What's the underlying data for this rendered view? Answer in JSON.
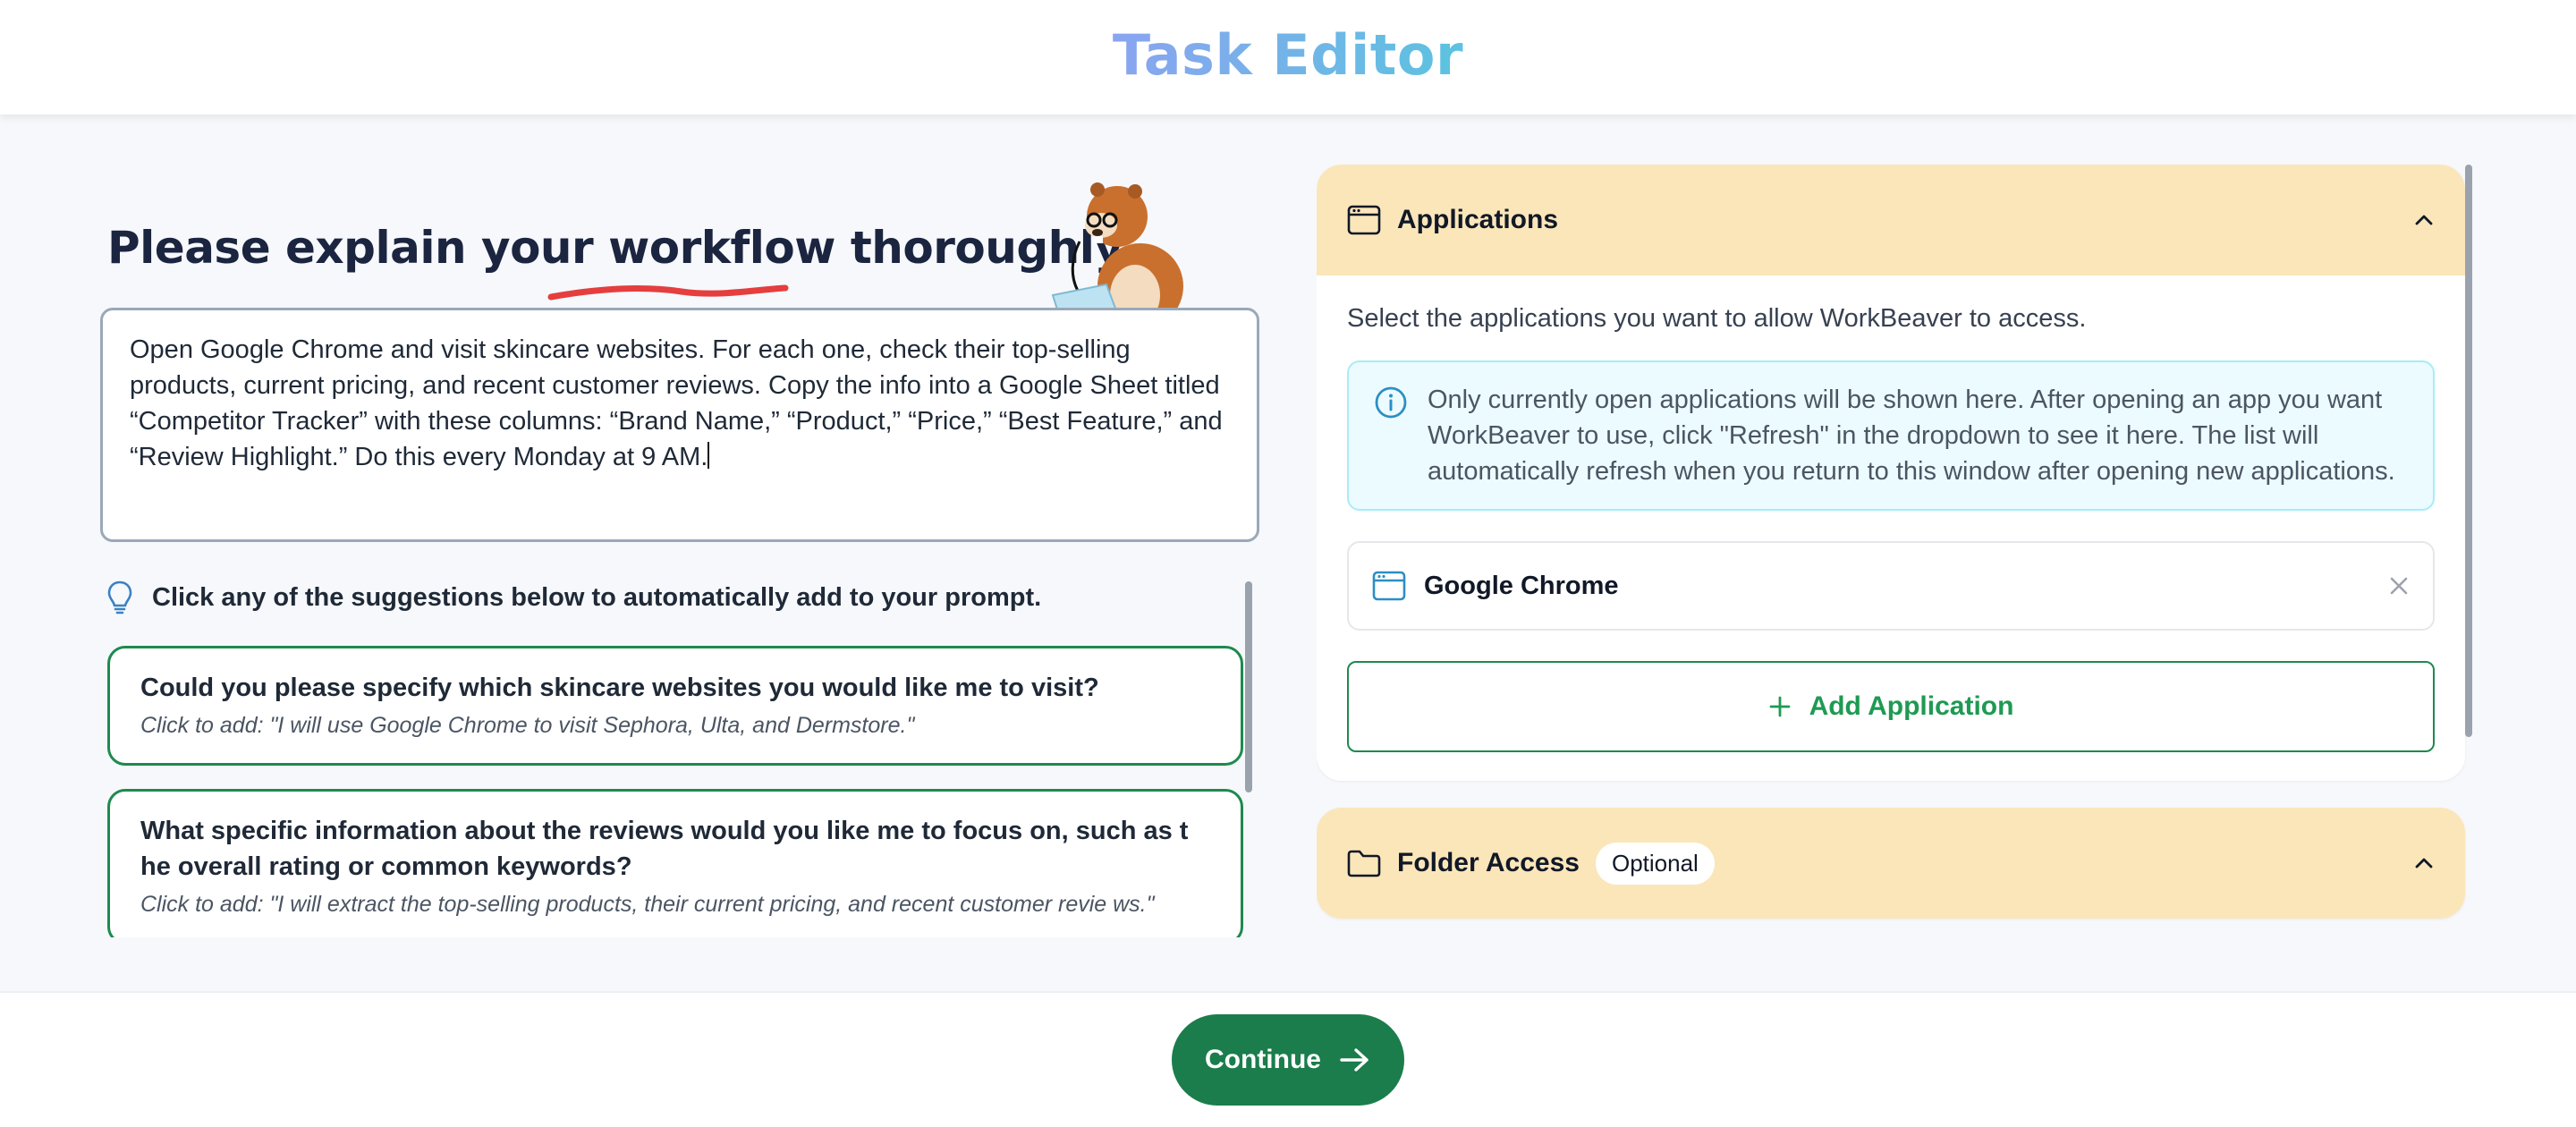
{
  "header": {
    "title": "Task Editor"
  },
  "left": {
    "headline": "Please explain your workflow thoroughly",
    "prompt_text": "Open Google Chrome and visit skincare websites. For each one, check their top-selling products, current pricing, and recent customer reviews. Copy the info into a Google Sheet titled “Competitor Tracker” with these columns: “Brand Name,” “Product,” “Price,” “Best Feature,” and “Review Highlight.” Do this every Monday at 9 AM.",
    "hint": "Click any of the suggestions below to automatically add to your prompt.",
    "suggestions": [
      {
        "question": "Could you please specify which skincare websites you would like me to visit?",
        "add": "Click to add: \"I will use Google Chrome to visit Sephora, Ulta, and Dermstore.\""
      },
      {
        "question": "What specific information about the reviews would you like me to focus on, such as t he overall rating or common keywords?",
        "add": "Click to add: \"I will extract the top-selling products, their current pricing, and recent customer revie ws.\""
      }
    ]
  },
  "applications": {
    "title": "Applications",
    "description": "Select the applications you want to allow WorkBeaver to access.",
    "info": "Only currently open applications will be shown here. After opening an app you want WorkBeaver to use, click \"Refresh\" in the dropdown to see it here. The list will automatically refresh when you return to this window after opening new applications.",
    "items": [
      {
        "name": "Google Chrome"
      }
    ],
    "add_label": "Add Application"
  },
  "folder_access": {
    "title": "Folder Access",
    "badge": "Optional"
  },
  "footer": {
    "continue_label": "Continue"
  },
  "colors": {
    "accent_green": "#1b7d4c",
    "panel_header": "#fbe6ba",
    "info_bg": "#ecfbff",
    "title_gradient_start": "#8aa4f0",
    "title_gradient_end": "#5cc3e0"
  }
}
